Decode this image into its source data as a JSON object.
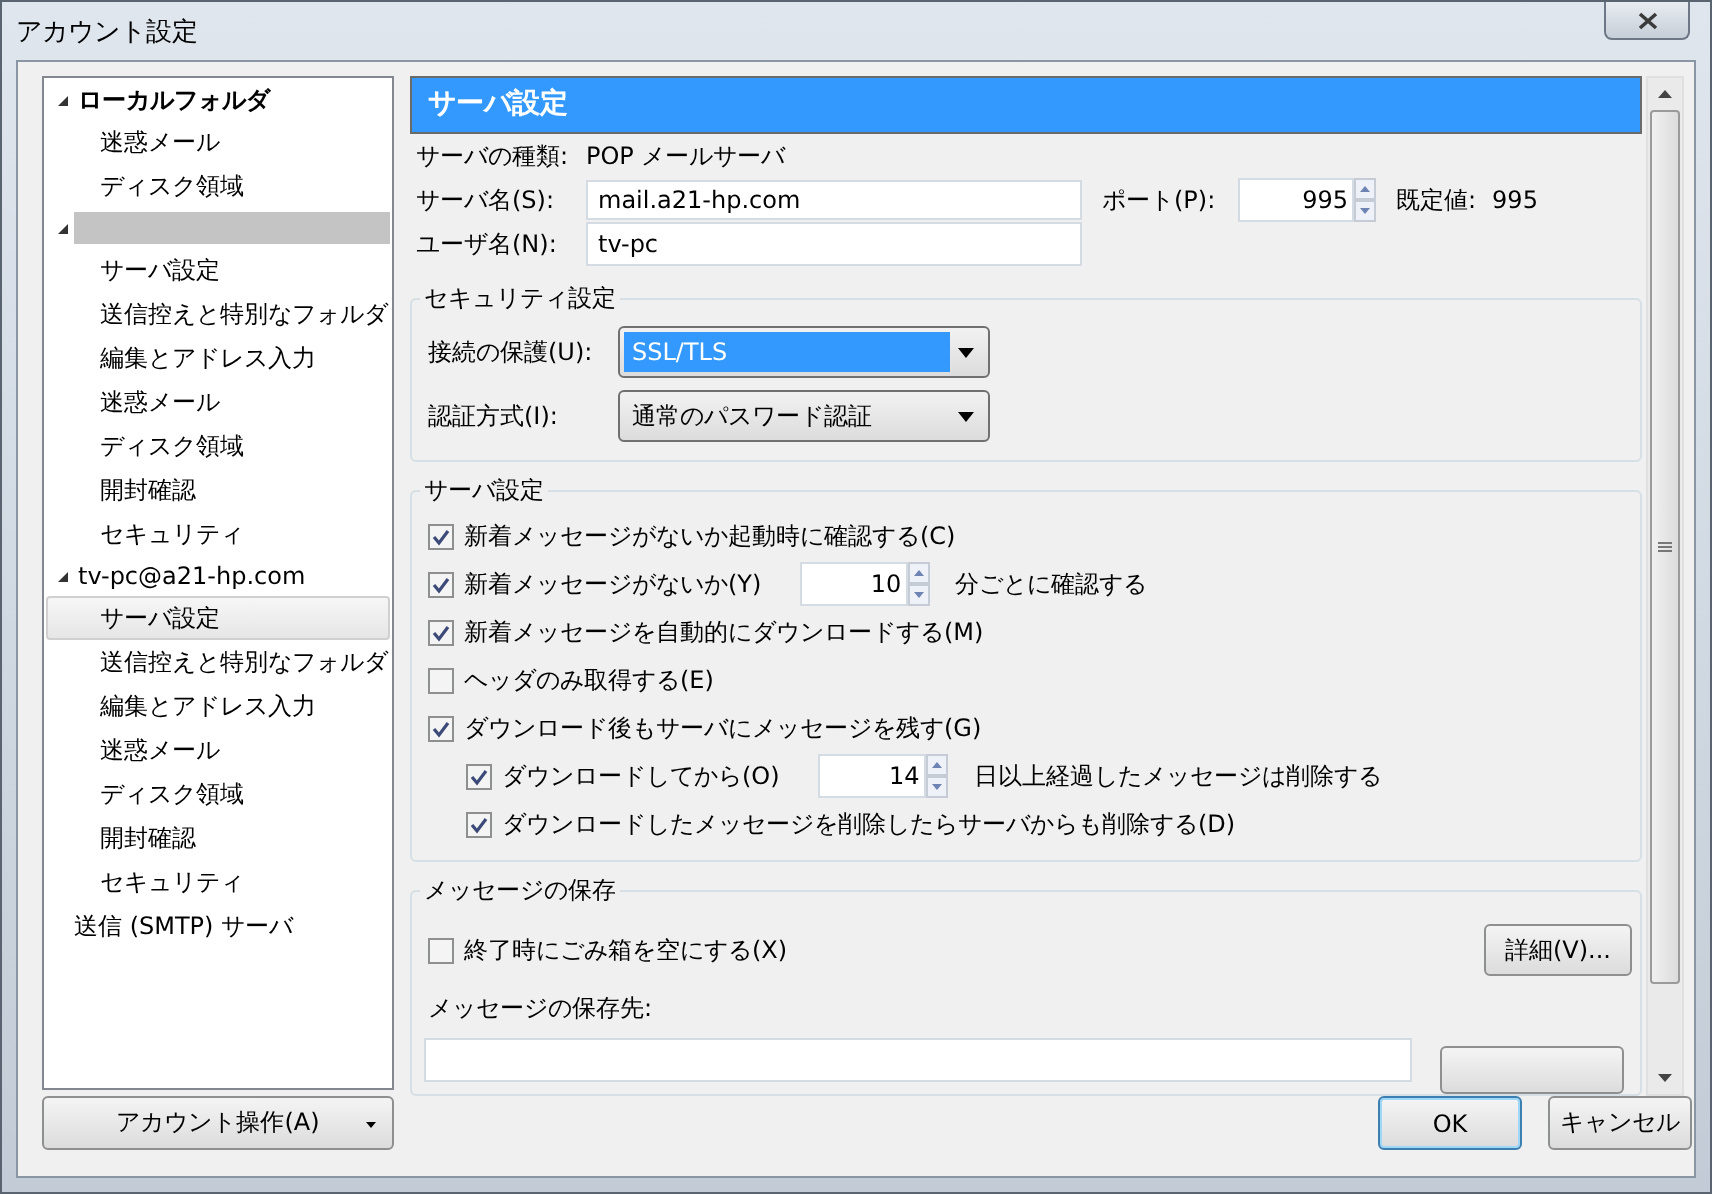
{
  "window": {
    "title": "アカウント設定"
  },
  "tree": [
    {
      "label": "ローカルフォルダ",
      "bold": true,
      "expanded": true,
      "children": [
        {
          "label": "迷惑メール",
          "selected": false
        },
        {
          "label": "ディスク領域",
          "selected": false
        }
      ]
    },
    {
      "redacted": true,
      "expanded": true,
      "children": [
        {
          "label": "サーバ設定",
          "selected": false
        },
        {
          "label": "送信控えと特別なフォルダ",
          "selected": false
        },
        {
          "label": "編集とアドレス入力",
          "selected": false
        },
        {
          "label": "迷惑メール",
          "selected": false
        },
        {
          "label": "ディスク領域",
          "selected": false
        },
        {
          "label": "開封確認",
          "selected": false
        },
        {
          "label": "セキュリティ",
          "selected": false
        }
      ]
    },
    {
      "label": "tv-pc@a21-hp.com",
      "bold": false,
      "expanded": true,
      "children": [
        {
          "label": "サーバ設定",
          "selected": true
        },
        {
          "label": "送信控えと特別なフォルダ",
          "selected": false
        },
        {
          "label": "編集とアドレス入力",
          "selected": false
        },
        {
          "label": "迷惑メール",
          "selected": false
        },
        {
          "label": "ディスク領域",
          "selected": false
        },
        {
          "label": "開封確認",
          "selected": false
        },
        {
          "label": "セキュリティ",
          "selected": false
        }
      ]
    },
    {
      "label": "送信 (SMTP) サーバ",
      "selected": false
    }
  ],
  "account_button": {
    "label": "アカウント操作(A)"
  },
  "panel": {
    "header": "サーバ設定",
    "server_type": {
      "label": "サーバの種類:",
      "value": "POP メールサーバ"
    },
    "server_name": {
      "label": "サーバ名(S):",
      "value": "mail.a21-hp.com"
    },
    "port": {
      "label": "ポート(P):",
      "value": "995"
    },
    "default_port": {
      "label": "既定値:",
      "value": "995"
    },
    "user_name": {
      "label": "ユーザ名(N):",
      "value": "tv-pc"
    }
  },
  "security": {
    "title": "セキュリティ設定",
    "rows": [
      {
        "label": "接続の保護(U):",
        "value": "SSL/TLS",
        "highlighted": true
      },
      {
        "label": "認証方式(I):",
        "value": "通常のパスワード認証",
        "highlighted": false
      }
    ]
  },
  "server_settings": {
    "title": "サーバ設定",
    "options": [
      {
        "label": "新着メッセージがないか起動時に確認する(C)",
        "checked": true
      },
      {
        "label": "新着メッセージがないか(Y)",
        "checked": true,
        "spin": "10",
        "suffix": "分ごとに確認する"
      },
      {
        "label": "新着メッセージを自動的にダウンロードする(M)",
        "checked": true
      },
      {
        "label": "ヘッダのみ取得する(E)",
        "checked": false
      },
      {
        "label": "ダウンロード後もサーバにメッセージを残す(G)",
        "checked": true,
        "children": [
          {
            "label": "ダウンロードしてから(O)",
            "checked": true,
            "spin": "14",
            "suffix": "日以上経過したメッセージは削除する"
          },
          {
            "label": "ダウンロードしたメッセージを削除したらサーバからも削除する(D)",
            "checked": true
          }
        ]
      }
    ]
  },
  "storage": {
    "title": "メッセージの保存",
    "options": [
      {
        "label": "終了時にごみ箱を空にする(X)",
        "checked": false
      }
    ],
    "advanced_button": "詳細(V)...",
    "location_label": "メッセージの保存先:"
  },
  "buttons": [
    {
      "label": "OK",
      "default": true
    },
    {
      "label": "キャンセル",
      "default": false
    }
  ]
}
